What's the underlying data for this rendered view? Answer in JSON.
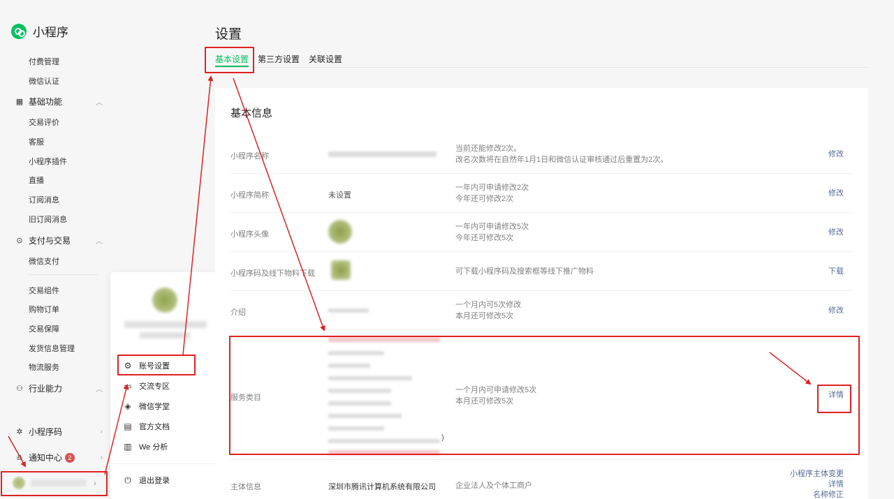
{
  "brand": {
    "name": "小程序",
    "logo_icon": "mini-program-logo-icon"
  },
  "sidebar": {
    "items_top": [
      {
        "label": "付费管理"
      },
      {
        "label": "微信认证"
      }
    ],
    "group_basic": {
      "label": "基础功能",
      "icon": "grid-icon"
    },
    "basic_items": [
      {
        "label": "交易评价"
      },
      {
        "label": "客服"
      },
      {
        "label": "小程序插件"
      },
      {
        "label": "直播"
      },
      {
        "label": "订阅消息"
      },
      {
        "label": "旧订阅消息"
      }
    ],
    "group_pay": {
      "label": "支付与交易",
      "icon": "pay-icon"
    },
    "pay_items": [
      {
        "label": "微信支付"
      },
      {
        "label": "交易组件"
      },
      {
        "label": "购物订单"
      },
      {
        "label": "交易保障"
      },
      {
        "label": "发货信息管理"
      },
      {
        "label": "物流服务"
      }
    ],
    "group_industry": {
      "label": "行业能力",
      "icon": "industry-icon"
    },
    "qrcode": {
      "label": "小程序码",
      "icon": "qrcode-icon"
    },
    "notify": {
      "label": "通知中心",
      "badge": "2",
      "icon": "bell-icon"
    }
  },
  "popup": {
    "items": [
      {
        "label": "账号设置",
        "icon": "gear-icon"
      },
      {
        "label": "交流专区",
        "icon": "chat-icon"
      },
      {
        "label": "微信学堂",
        "icon": "graduation-cap-icon"
      },
      {
        "label": "官方文档",
        "icon": "document-icon"
      },
      {
        "label": "We 分析",
        "icon": "analytics-icon"
      }
    ],
    "logout": {
      "label": "退出登录",
      "icon": "power-icon"
    }
  },
  "page": {
    "title": "设置"
  },
  "tabs": [
    {
      "label": "基本设置",
      "active": true
    },
    {
      "label": "第三方设置",
      "active": false
    },
    {
      "label": "关联设置",
      "active": false
    }
  ],
  "card": {
    "title": "基本信息",
    "rows": [
      {
        "label": "小程序名称",
        "value": "",
        "desc": [
          "当前还能修改2次。",
          "改名次数将在自然年1月1日和微信认证审核通过后重置为2次。"
        ],
        "action": "修改"
      },
      {
        "label": "小程序简称",
        "value": "未设置",
        "desc": [
          "一年内可申请修改2次",
          "今年还可修改2次"
        ],
        "action": "修改"
      },
      {
        "label": "小程序头像",
        "value": "",
        "desc": [
          "一年内可申请修改5次",
          "今年还可修改5次"
        ],
        "action": "修改"
      },
      {
        "label": "小程序码及线下物料下载",
        "value": "",
        "desc": [
          "可下载小程序码及搜索框等线下推广物料"
        ],
        "action": "下载"
      },
      {
        "label": "介绍",
        "value": "",
        "desc": [
          "一个月内可5次修改",
          "本月还可修改5次"
        ],
        "action": "修改"
      },
      {
        "label": "服务类目",
        "value": "",
        "value_tail": ")",
        "desc": [
          "一个月内可申请修改5次",
          "本月还可修改5次"
        ],
        "action": "详情"
      },
      {
        "label": "主体信息",
        "value": "深圳市腾讯计算机系统有限公司",
        "desc": [
          "企业法人及个体工商户"
        ],
        "actions": [
          "小程序主体变更",
          "详情",
          "名称修正"
        ]
      }
    ]
  },
  "colors": {
    "accent": "#07c160",
    "link": "#576b95",
    "annotation": "#e02020",
    "badge": "#d9534f"
  }
}
